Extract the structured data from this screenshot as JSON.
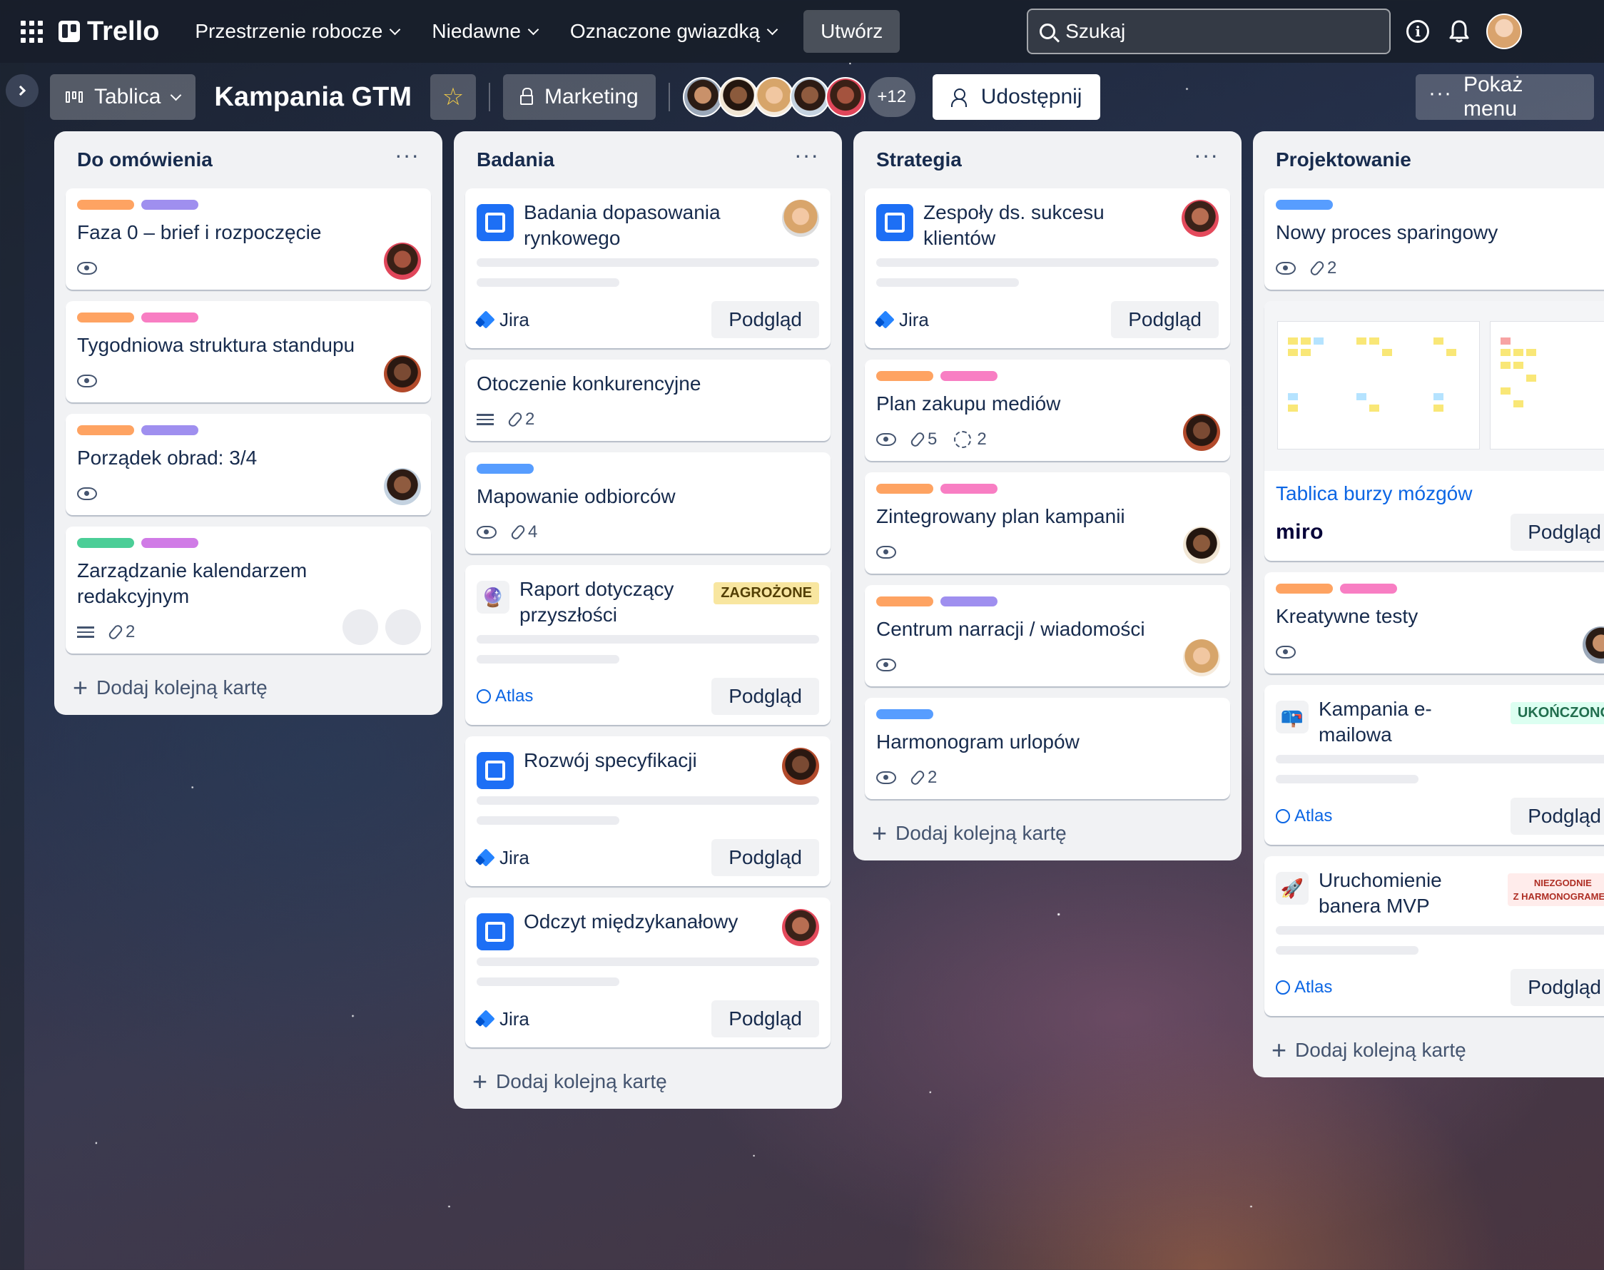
{
  "topbar": {
    "app_name": "Trello",
    "nav": [
      "Przestrzenie robocze",
      "Niedawne",
      "Oznaczone gwiazdką"
    ],
    "create_label": "Utwórz",
    "search_placeholder": "Szukaj",
    "info_glyph": "i"
  },
  "board": {
    "view_label": "Tablica",
    "title": "Kampania GTM",
    "workspace_label": "Marketing",
    "members_more": "+12",
    "share_label": "Udostępnij",
    "menu_label": "Pokaż menu"
  },
  "colors": {
    "orange": "#fea362",
    "purple": "#9f8fef",
    "pink": "#f87ec3",
    "blue": "#579dff",
    "green": "#4bce97",
    "magenta": "#d07be6"
  },
  "common": {
    "add_card": "Dodaj kolejną kartę",
    "preview": "Podgląd",
    "jira": "Jira",
    "atlas": "Atlas",
    "miro": "miro"
  },
  "lists": [
    {
      "title": "Do omówienia",
      "cards": [
        {
          "title": "Faza 0 – brief i rozpoczęcie"
        },
        {
          "title": "Tygodniowa struktura standupu"
        },
        {
          "title": "Porządek obrad: 3/4"
        },
        {
          "title": "Zarządzanie kalendarzem redakcyjnym",
          "attachments": "2"
        }
      ]
    },
    {
      "title": "Badania",
      "cards": [
        {
          "title": "Badania dopasowania rynkowego"
        },
        {
          "title": "Otoczenie konkurencyjne",
          "attachments": "2"
        },
        {
          "title": "Mapowanie odbiorców",
          "attachments": "4"
        },
        {
          "title": "Raport dotyczący przyszłości",
          "status": "ZAGROŻONE"
        },
        {
          "title": "Rozwój specyfikacji"
        },
        {
          "title": "Odczyt międzykanałowy"
        }
      ]
    },
    {
      "title": "Strategia",
      "cards": [
        {
          "title": "Zespoły ds. sukcesu klientów"
        },
        {
          "title": "Plan zakupu mediów",
          "attachments": "5",
          "checklist": "2"
        },
        {
          "title": "Zintegrowany plan kampanii"
        },
        {
          "title": "Centrum narracji / wiadomości"
        },
        {
          "title": "Harmonogram urlopów",
          "attachments": "2"
        }
      ]
    },
    {
      "title": "Projektowanie",
      "cards": [
        {
          "title": "Nowy proces sparingowy",
          "attachments": "2"
        },
        {
          "title": "Tablica burzy mózgów"
        },
        {
          "title": "Kreatywne testy"
        },
        {
          "title": "Kampania e-mailowa",
          "status": "UKOŃCZONO"
        },
        {
          "title": "Uruchomienie banera MVP",
          "status_line1": "NIEZGODNIE",
          "status_line2": "Z HARMONOGRAMEM"
        }
      ]
    }
  ]
}
